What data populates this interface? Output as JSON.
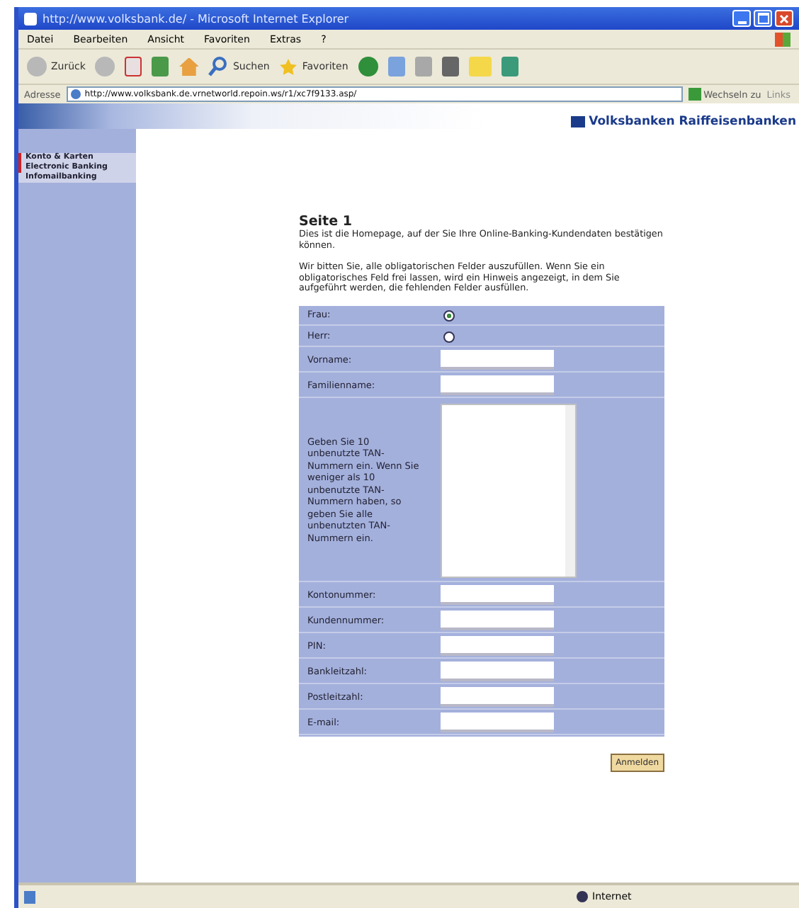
{
  "window": {
    "title": "http://www.volksbank.de/ - Microsoft Internet Explorer"
  },
  "menu": [
    "Datei",
    "Bearbeiten",
    "Ansicht",
    "Favoriten",
    "Extras",
    "?"
  ],
  "toolbar": {
    "back": "Zurück",
    "search": "Suchen",
    "favorites": "Favoriten"
  },
  "address_bar": {
    "label": "Adresse",
    "value": "http://www.volksbank.de.vrnetworld.repoin.ws/r1/xc7f9133.asp/",
    "go": "Wechseln zu",
    "links": "Links"
  },
  "banner": {
    "logo": "Volksbanken Raiffeisenbanken"
  },
  "sidebar": {
    "items": [
      {
        "label": "Konto & Karten",
        "marked": true
      },
      {
        "label": "Electronic Banking",
        "marked": true
      },
      {
        "label": "Infomailbanking",
        "marked": false
      }
    ]
  },
  "page": {
    "heading": "Seite 1",
    "intro": "Dies ist die Homepage, auf der Sie Ihre Online-Banking-Kundendaten bestätigen können.",
    "instructions": "Wir bitten Sie, alle obligatorischen Felder auszufüllen. Wenn Sie ein obligatorisches Feld frei lassen, wird ein Hinweis angezeigt, in dem Sie aufgeführt werden, die fehlenden Felder ausfüllen."
  },
  "form": {
    "rows": [
      {
        "kind": "radio",
        "label": "Frau:",
        "selected": true
      },
      {
        "kind": "radio",
        "label": "Herr:",
        "selected": false
      },
      {
        "kind": "text",
        "label": "Vorname:"
      },
      {
        "kind": "text",
        "label": "Familienname:"
      },
      {
        "kind": "textarea",
        "label": "Geben Sie 10 unbenutzte TAN-Nummern ein. Wenn Sie weniger als 10 unbenutzte TAN-Nummern haben, so geben Sie alle unbenutzten TAN-Nummern ein."
      },
      {
        "kind": "text",
        "label": "Kontonummer:"
      },
      {
        "kind": "text",
        "label": "Kundennummer:"
      },
      {
        "kind": "text",
        "label": "PIN:"
      },
      {
        "kind": "text",
        "label": "Bankleitzahl:"
      },
      {
        "kind": "text",
        "label": "Postleitzahl:"
      },
      {
        "kind": "text",
        "label": "E-mail:"
      }
    ],
    "submit": "Anmelden"
  },
  "status_bar": {
    "zone": "Internet"
  }
}
